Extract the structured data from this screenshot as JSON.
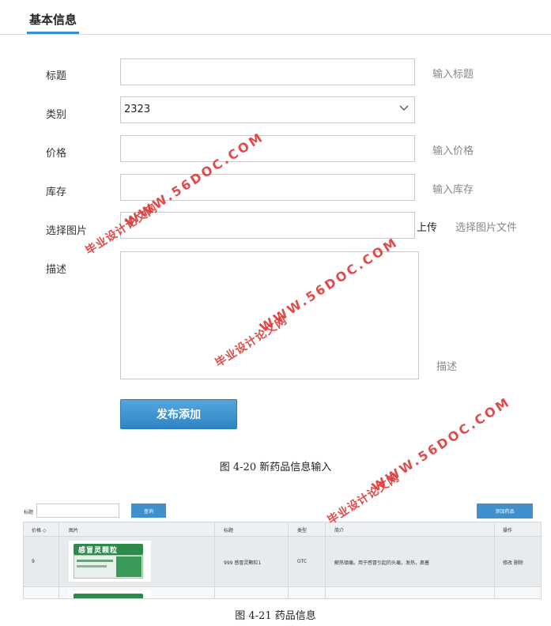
{
  "form": {
    "tab_title": "基本信息",
    "title_label": "标题",
    "title_hint": "输入标题",
    "category_label": "类别",
    "category_value": "2323",
    "price_label": "价格",
    "price_hint": "输入价格",
    "stock_label": "库存",
    "stock_hint": "输入库存",
    "image_label": "选择图片",
    "upload_label": "上传",
    "image_hint": "选择图片文件",
    "desc_label": "描述",
    "desc_hint": "描述",
    "publish_label": "发布添加"
  },
  "caption_1": "图 4-20 新药品信息输入",
  "list": {
    "search_label": "标题",
    "query_label": "查询",
    "add_label": "添加药品",
    "columns": [
      "价格 ◇",
      "图片",
      "标题",
      "类型",
      "简介",
      "操作"
    ],
    "rows": [
      {
        "price": "9",
        "title": "999 感冒灵颗粒1",
        "type": "OTC",
        "intro": "解热镇痛。用于感冒引起的头痛，发热，鼻塞",
        "actions": "修改 删除",
        "image_label": "感冒灵颗粒"
      }
    ]
  },
  "caption_2": "图 4-21 药品信息",
  "watermarks": {
    "url": "WWW.56DOC.COM",
    "cn": "毕业设计论文网"
  },
  "colors": {
    "accent": "#3c8fcf",
    "watermark": "#e03a3a"
  }
}
